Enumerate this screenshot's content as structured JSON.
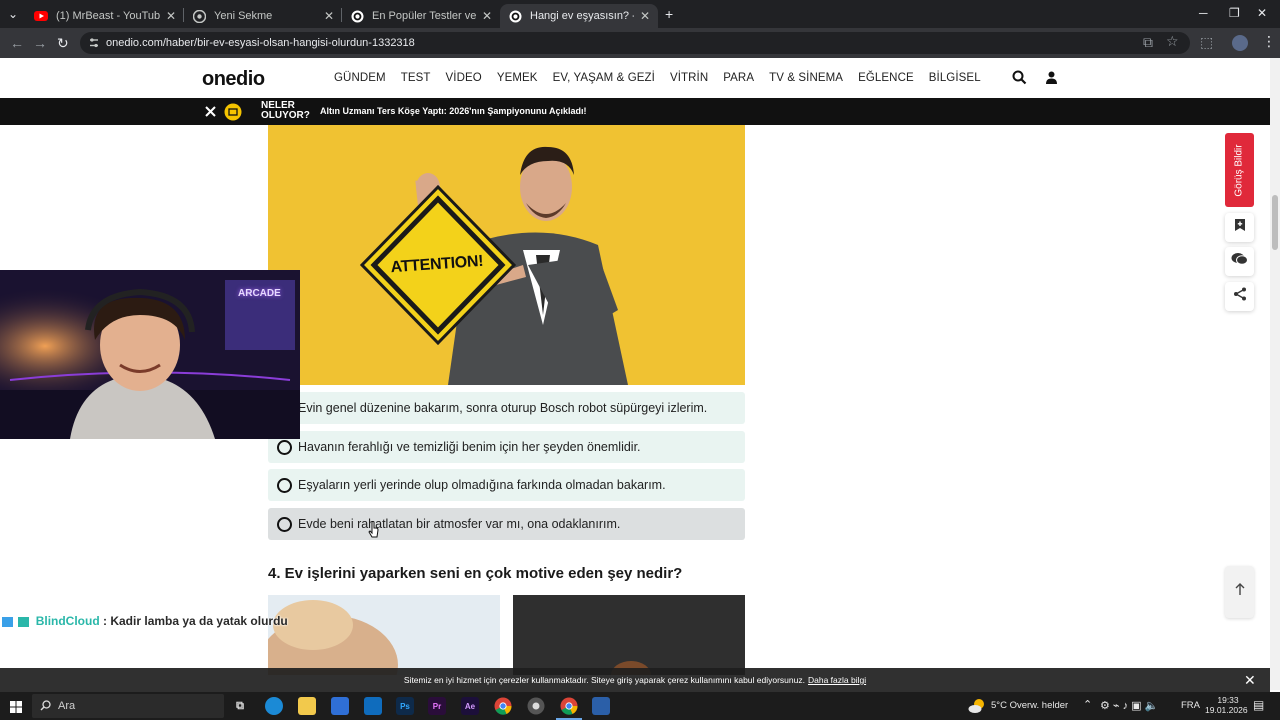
{
  "browser": {
    "tabs": [
      {
        "title": "(1) MrBeast - YouTube",
        "active": false
      },
      {
        "title": "Yeni Sekme",
        "active": false
      },
      {
        "title": "En Popüler Testler ve Eğlenceli",
        "active": false
      },
      {
        "title": "Hangi ev eşyasısın? - Onedio",
        "active": true
      }
    ],
    "url": "onedio.com/haber/bir-ev-esyasi-olsan-hangisi-olurdun-1332318"
  },
  "site": {
    "logo": "onedio",
    "menu": [
      "GÜNDEM",
      "TEST",
      "VİDEO",
      "YEMEK",
      "EV, YAŞAM & GEZİ",
      "VİTRİN",
      "PARA",
      "TV & SİNEMA",
      "EĞLENCE",
      "BİLGİSEL"
    ],
    "ticker_label_1": "NELER",
    "ticker_label_2": "OLUYOR?",
    "ticker_headline": "Altın Uzmanı Ters Köşe Yaptı: 2026'nın Şampiyonunu Açıkladı!"
  },
  "quiz": {
    "hero_sign_text": "ATTENTION!",
    "options": [
      "Evin genel düzenine bakarım, sonra oturup Bosch robot süpürgeyi izlerim.",
      "Havanın ferahlığı ve temizliği benim için her şeyden önemlidir.",
      "Eşyaların yerli yerinde olup olmadığına farkında olmadan bakarım.",
      "Evde beni rahatlatan bir atmosfer var mı, ona odaklanırım."
    ],
    "next_question": "4. Ev işlerini yaparken seni en çok motive eden şey nedir?"
  },
  "side": {
    "feedback_label": "Görüş Bildir"
  },
  "stream": {
    "sign": "ARCADE",
    "chat_user": "BlindCloud",
    "chat_message": ": Kadir lamba ya da yatak olurdu"
  },
  "cookie": {
    "text": "Sitemiz en iyi hizmet için çerezler kullanmaktadır. Siteye giriş yaparak çerez kullanımını kabul ediyorsunuz.",
    "link": "Daha fazla bilgi"
  },
  "taskbar": {
    "search_placeholder": "Ara",
    "weather": "5°C  Overw. helder",
    "lang": "FRA",
    "time": "19:33",
    "date": "19.01.2026"
  },
  "colors": {
    "option_bg": "#e9f4f1",
    "hero_bg": "#f0c232",
    "feedback_red": "#e0293a"
  }
}
